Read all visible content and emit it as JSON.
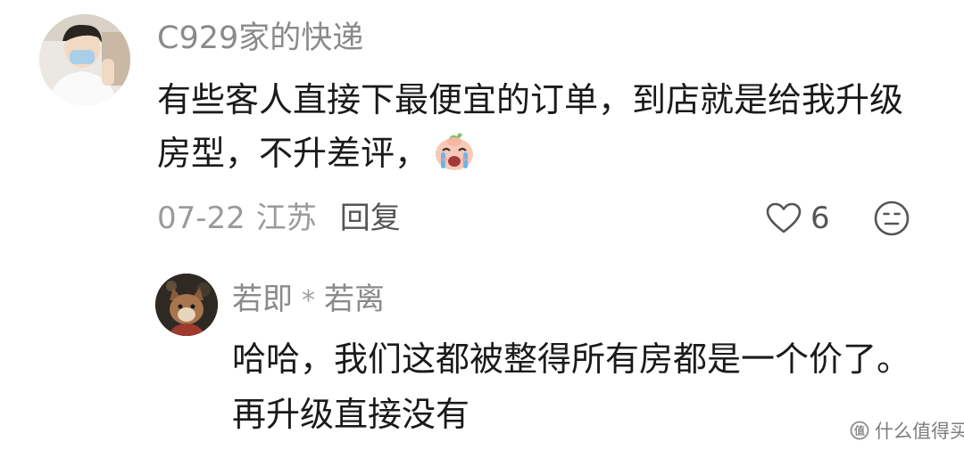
{
  "comment": {
    "username": "C929家的快递",
    "text": "有些客人直接下最便宜的订单，到店就是给我升级房型，不升差评，",
    "emoji": "crying-face-emoji",
    "date": "07-22",
    "location": "江苏",
    "reply_label": "回复",
    "like_count": "6"
  },
  "reply": {
    "username_part1": "若即",
    "separator": "*",
    "username_part2": "若离",
    "text": "哈哈，我们这都被整得所有房都是一个价了。再升级直接没有"
  },
  "watermark": {
    "text": "什么值得买"
  },
  "colors": {
    "meta_gray": "#9a9a9a",
    "text_black": "#1a1a1a",
    "icon_gray": "#555555"
  }
}
